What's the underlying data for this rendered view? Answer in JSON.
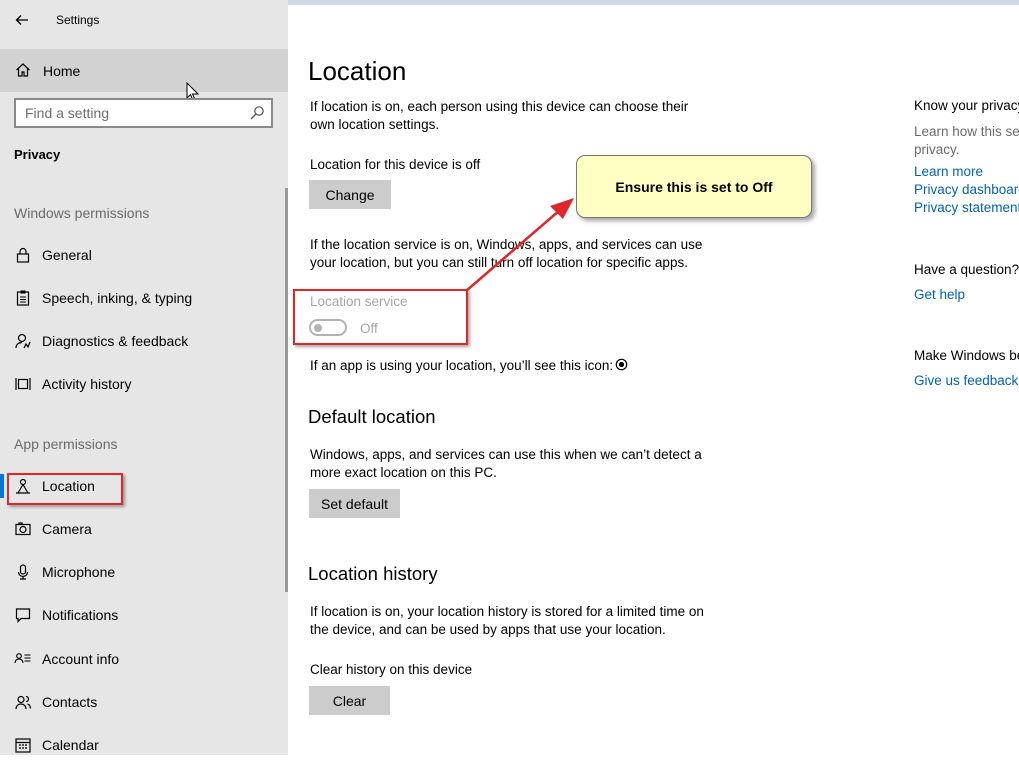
{
  "app": {
    "title": "Settings"
  },
  "sidebar": {
    "home_label": "Home",
    "search_placeholder": "Find a setting",
    "section_title": "Privacy",
    "groups": [
      "Windows permissions",
      "App permissions"
    ],
    "windows_permissions": [
      {
        "label": "General",
        "icon": "lock-icon"
      },
      {
        "label": "Speech, inking, & typing",
        "icon": "clipboard-icon"
      },
      {
        "label": "Diagnostics & feedback",
        "icon": "diagnostics-icon"
      },
      {
        "label": "Activity history",
        "icon": "activity-history-icon"
      }
    ],
    "app_permissions": [
      {
        "label": "Location",
        "icon": "location-icon",
        "selected": true
      },
      {
        "label": "Camera",
        "icon": "camera-icon"
      },
      {
        "label": "Microphone",
        "icon": "microphone-icon"
      },
      {
        "label": "Notifications",
        "icon": "notifications-icon"
      },
      {
        "label": "Account info",
        "icon": "account-info-icon"
      },
      {
        "label": "Contacts",
        "icon": "contacts-icon"
      },
      {
        "label": "Calendar",
        "icon": "calendar-icon"
      }
    ]
  },
  "main": {
    "title": "Location",
    "intro_line1": "If location is on, each person using this device can choose their",
    "intro_line2": "own location settings.",
    "device_status": "Location for this device is off",
    "change_button": "Change",
    "service_desc_line1": "If the location service is on, Windows, apps, and services can use",
    "service_desc_line2": "your location, but you can still turn off location for specific apps.",
    "service_toggle_label": "Location service",
    "service_toggle_state": "Off",
    "service_toggle_on": false,
    "icon_note": "If an app is using your location, you’ll see this icon:",
    "default_location": {
      "heading": "Default location",
      "desc_line1": "Windows, apps, and services can use this when we can’t detect a",
      "desc_line2": "more exact location on this PC.",
      "button": "Set default"
    },
    "location_history": {
      "heading": "Location history",
      "desc_line1": "If location is on, your location history is stored for a limited time on",
      "desc_line2": "the device, and can be used by apps that use your location.",
      "clear_label": "Clear history on this device",
      "button": "Clear"
    }
  },
  "right_panel": {
    "know_heading": "Know your privacy",
    "know_text_line1": "Learn how this se",
    "know_text_line2": "privacy.",
    "links": [
      "Learn more",
      "Privacy dashboard",
      "Privacy statement"
    ],
    "question_heading": "Have a question?",
    "help_link": "Get help",
    "better_heading": "Make Windows be",
    "feedback_link": "Give us feedback"
  },
  "annotation": {
    "callout_text": "Ensure this is set to Off",
    "highlight_color": "#e0262a",
    "callout_color": "#ffffc4"
  },
  "colors": {
    "accent": "#0078d7",
    "link": "#0063b1",
    "sidebar_bg": "#e6e6e6"
  }
}
